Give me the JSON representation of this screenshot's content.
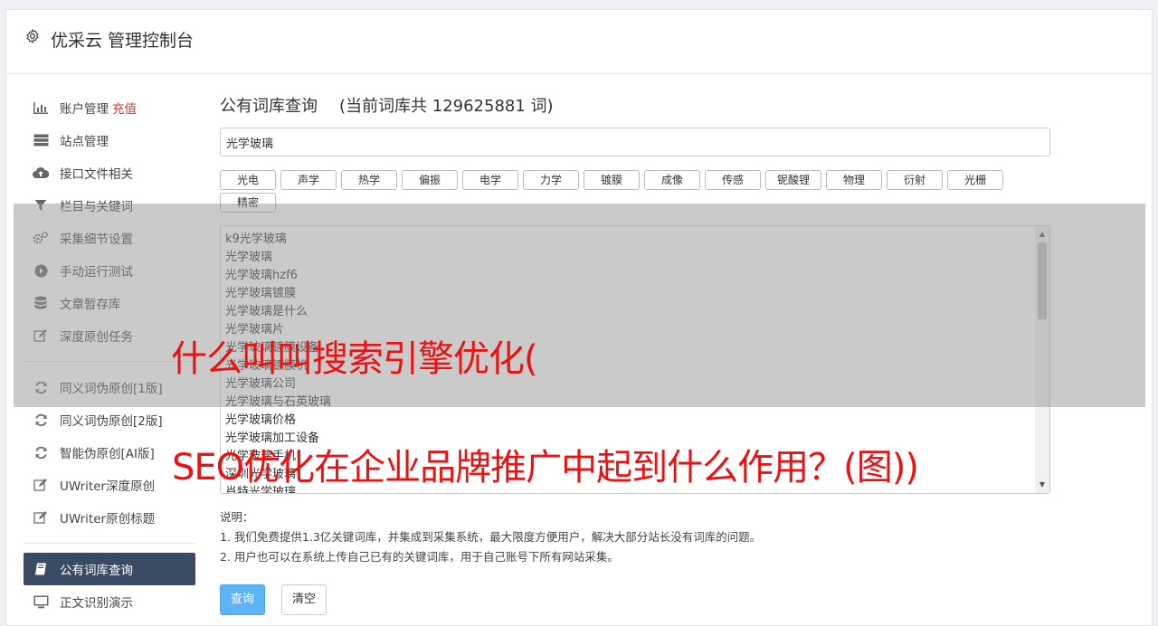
{
  "header": {
    "title": "优采云 管理控制台"
  },
  "sidebar": {
    "group1": [
      {
        "label": "账户管理",
        "badge": "充值",
        "icon": "bar-chart-icon"
      },
      {
        "label": "站点管理",
        "icon": "server-icon"
      },
      {
        "label": "接口文件相关",
        "icon": "cloud-upload-icon"
      },
      {
        "label": "栏目与关键词",
        "icon": "filter-icon"
      },
      {
        "label": "采集细节设置",
        "icon": "gears-icon"
      },
      {
        "label": "手动运行测试",
        "icon": "play-circle-icon"
      },
      {
        "label": "文章暂存库",
        "icon": "database-icon"
      },
      {
        "label": "深度原创任务",
        "icon": "edit-icon"
      }
    ],
    "group2": [
      {
        "label": "同义词伪原创[1版]",
        "icon": "refresh-icon"
      },
      {
        "label": "同义词伪原创[2版]",
        "icon": "refresh-icon"
      },
      {
        "label": "智能伪原创[AI版]",
        "icon": "refresh-icon"
      },
      {
        "label": "UWriter深度原创",
        "icon": "edit-icon"
      },
      {
        "label": "UWriter原创标题",
        "icon": "edit-icon"
      }
    ],
    "group3": [
      {
        "label": "公有词库查询",
        "icon": "book-icon",
        "active": true
      },
      {
        "label": "正文识别演示",
        "icon": "monitor-icon"
      }
    ]
  },
  "main": {
    "title": "公有词库查询",
    "count_text": "(当前词库共 129625881 词)",
    "search_value": "光学玻璃",
    "tags": [
      "光电",
      "声学",
      "热学",
      "偏振",
      "电学",
      "力学",
      "镀膜",
      "成像",
      "传感",
      "铌酸锂",
      "物理",
      "衍射",
      "光栅",
      "精密"
    ],
    "results": [
      "k9光学玻璃",
      "光学玻璃",
      "光学玻璃hzf6",
      "光学玻璃镀膜",
      "光学玻璃是什么",
      "光学玻璃片",
      "光学玻璃镀膜设备",
      "光学玻璃镀膜机",
      "光学玻璃公司",
      "光学玻璃与石英玻璃",
      "光学玻璃价格",
      "光学玻璃加工设备",
      "光学玻璃手机",
      "深圳光学玻璃",
      "肖特光学玻璃"
    ],
    "notes_title": "说明：",
    "notes": [
      "1. 我们免费提供1.3亿关键词库，并集成到采集系统，最大限度方便用户，解决大部分站长没有词库的问题。",
      "2. 用户也可以在系统上传自己已有的关键词库，用于自己账号下所有网站采集。"
    ],
    "query_button": "查询",
    "clear_button": "清空"
  },
  "overlay": {
    "line1": "什么叫叫搜索引擎优化(",
    "line2": "SEO优化在企业品牌推广中起到什么作用？(图))",
    "text_color": "#ee1111"
  },
  "colors": {
    "active_bg": "#3a4a63",
    "primary": "#5cb3f5",
    "badge_red": "#d9322f"
  }
}
